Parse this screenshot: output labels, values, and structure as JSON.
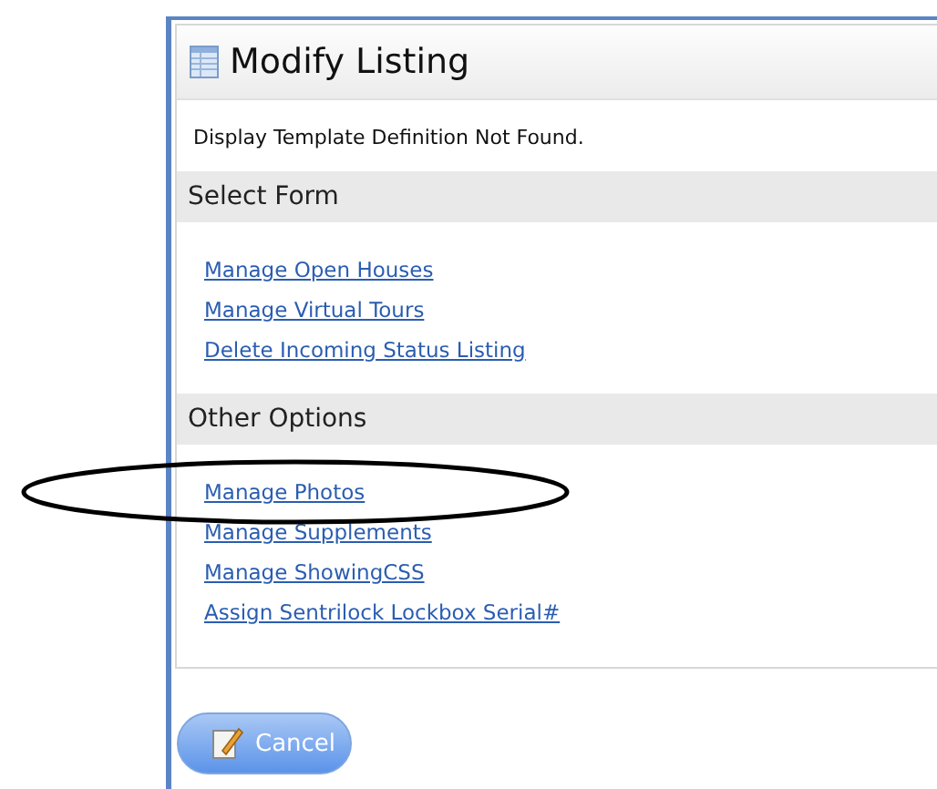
{
  "panel": {
    "title": "Modify Listing",
    "message": "Display Template Definition Not Found."
  },
  "sections": [
    {
      "heading": "Select Form",
      "links": [
        "Manage Open Houses",
        "Manage Virtual Tours",
        "Delete Incoming Status Listing"
      ]
    },
    {
      "heading": "Other Options",
      "links": [
        "Manage Photos",
        "Manage Supplements",
        "Manage ShowingCSS",
        "Assign Sentrilock Lockbox Serial#"
      ]
    }
  ],
  "buttons": [
    {
      "label": "Cancel"
    }
  ]
}
